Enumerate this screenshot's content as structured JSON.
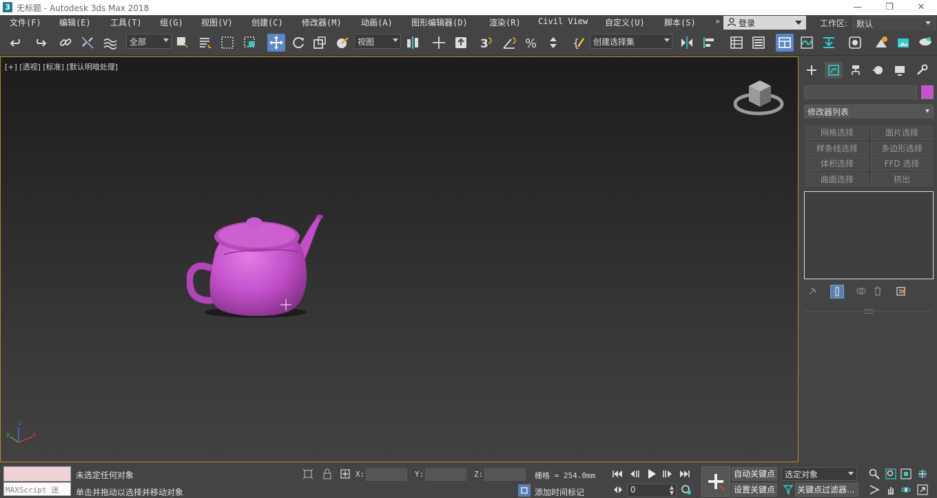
{
  "window": {
    "app_icon": "3",
    "title": "无标题 - Autodesk 3ds Max 2018",
    "controls": {
      "minimize": "—",
      "maximize": "❐",
      "close": "✕"
    }
  },
  "menubar": {
    "items": [
      "文件(F)",
      "编辑(E)",
      "工具(T)",
      "组(G)",
      "视图(V)",
      "创建(C)",
      "修改器(M)",
      "动画(A)",
      "图形编辑器(D)",
      "渲染(R)",
      "Civil View",
      "自定义(U)",
      "脚本(S)"
    ],
    "overflow": "»",
    "login": "登录",
    "workspace_label": "工作区:",
    "workspace_value": "默认"
  },
  "toolbar": {
    "selection_filter": "全部",
    "ref_coord": "视图",
    "named_selection_placeholder": "创建选择集"
  },
  "viewport": {
    "label": "[+] [透视] [标准] [默认明暗处理]",
    "object_color": "#c24fc8",
    "border_color": "#b38b2d",
    "axis_labels": {
      "x": "x",
      "y": "y",
      "z": "z"
    }
  },
  "command_panel": {
    "object_color": "#cc4fd2",
    "modifier_list": "修改器列表",
    "modifier_buttons": [
      "网格选择",
      "面片选择",
      "样条线选择",
      "多边形选择",
      "体积选择",
      "FFD 选择",
      "曲面选择",
      "挤出"
    ]
  },
  "statusbar": {
    "maxscript": "MAXScript 迷",
    "status_line1": "未选定任何对象",
    "status_line2": "单击并拖动以选择并移动对象",
    "x_label": "X:",
    "y_label": "Y:",
    "z_label": "Z:",
    "grid": "栅格 = 254.0mm",
    "add_time_tag": "添加时间标记",
    "frame_value": "0",
    "auto_key": "自动关键点",
    "set_key": "设置关键点",
    "selected_object": "选定对象",
    "key_filters": "关键点过滤器..."
  }
}
